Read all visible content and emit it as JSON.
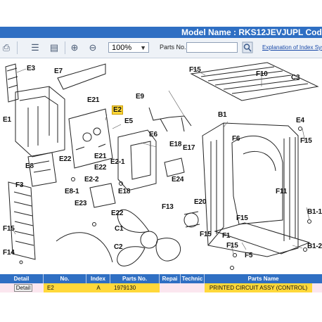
{
  "header": {
    "model": "Model Name : RKS12JEVJU",
    "plcode": "PL Cod"
  },
  "toolbar": {
    "zoom_value": "100%",
    "parts_no_label": "Parts No.",
    "parts_no_value": "",
    "explanation_link": "Explanation of Index Sys"
  },
  "diagram": {
    "labels": {
      "E3": "E3",
      "E7": "E7",
      "E9": "E9",
      "F15a": "F15",
      "F10": "F10",
      "C3": "C3",
      "E21a": "E21",
      "E2": "E2",
      "E1": "E1",
      "E5": "E5",
      "B1": "B1",
      "E4": "E4",
      "E6": "E6",
      "E18a": "E18",
      "E17": "E17",
      "F6": "F6",
      "F15b": "F15",
      "E8": "E8",
      "E22a": "E22",
      "E21b": "E21",
      "E22b": "E22",
      "E2_1": "E2-1",
      "E24": "E24",
      "E2_2": "E2-2",
      "F3": "F3",
      "E8_1": "E8-1",
      "E18b": "E18",
      "F11": "F11",
      "E23": "E23",
      "F13": "F13",
      "E20": "E20",
      "F15c": "F15",
      "B1_1": "B1-1",
      "F15d": "F15",
      "E22c": "E22",
      "C1": "C1",
      "F15e": "F15",
      "F1": "F1",
      "F15f": "F15",
      "B1_2": "B1-2",
      "F14": "F14",
      "C2": "C2",
      "F5": "F5"
    }
  },
  "table": {
    "headers": [
      "Detail",
      "No.",
      "Index",
      "Parts No.",
      "Repai",
      "Technic",
      "Parts Name"
    ],
    "row": {
      "detail_button": "Detail",
      "no": "E2",
      "index": "A",
      "parts_no": "1979130",
      "repair": "",
      "technic": "",
      "parts_name": "PRINTED CIRCUIT ASSY (CONTROL)"
    }
  },
  "colors": {
    "header_blue": "#2f6fc3",
    "highlight_yellow": "#ffd83a",
    "row_pink": "#fbe6ef"
  }
}
